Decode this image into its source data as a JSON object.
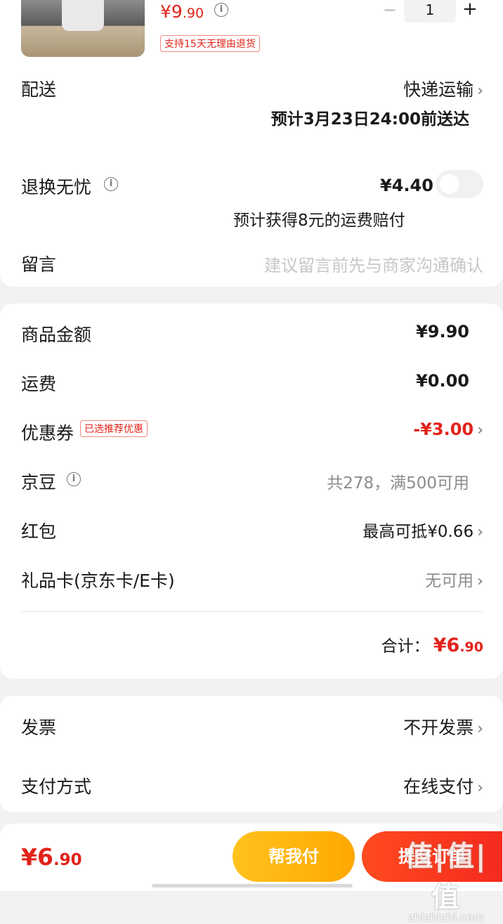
{
  "product": {
    "price_int": "¥9",
    "price_dec": ".90",
    "quantity": "1",
    "minus": "−",
    "plus": "+",
    "return_tag": "支持15天无理由退货"
  },
  "delivery": {
    "label": "配送",
    "method": "快递运输",
    "eta": "预计3月23日24:00前送达"
  },
  "return_insurance": {
    "label": "退换无忧",
    "price": "¥4.40",
    "note": "预计获得8元的运费赔付"
  },
  "message": {
    "label": "留言",
    "placeholder": "建议留言前先与商家沟通确认"
  },
  "costs": {
    "goods_label": "商品金额",
    "goods_value": "¥9.90",
    "shipping_label": "运费",
    "shipping_value": "¥0.00",
    "coupon_label": "优惠券",
    "coupon_tag": "已选推荐优惠",
    "coupon_value": "-¥3.00",
    "jingdou_label": "京豆",
    "jingdou_value": "共278，满500可用",
    "redpacket_label": "红包",
    "redpacket_value": "最高可抵¥0.66",
    "giftcard_label": "礼品卡(京东卡/E卡)",
    "giftcard_value": "无可用",
    "total_label": "合计：",
    "total_int": "¥6",
    "total_dec": ".90"
  },
  "invoice": {
    "label": "发票",
    "value": "不开发票"
  },
  "payment": {
    "label": "支付方式",
    "value": "在线支付"
  },
  "bottom": {
    "price_int": "¥6",
    "price_dec": ".90",
    "help_pay": "帮我付",
    "submit": "提交订单"
  },
  "watermark": {
    "main": "值|值|值",
    "sub": "zhizhizhi.com"
  },
  "icons": {
    "info": "info-icon",
    "chevron": "chevron-right-icon",
    "toggle": "toggle-switch"
  },
  "colors": {
    "accent_red": "#e2231a",
    "help_pay": "#ffb400",
    "submit": "#f23a1e"
  }
}
